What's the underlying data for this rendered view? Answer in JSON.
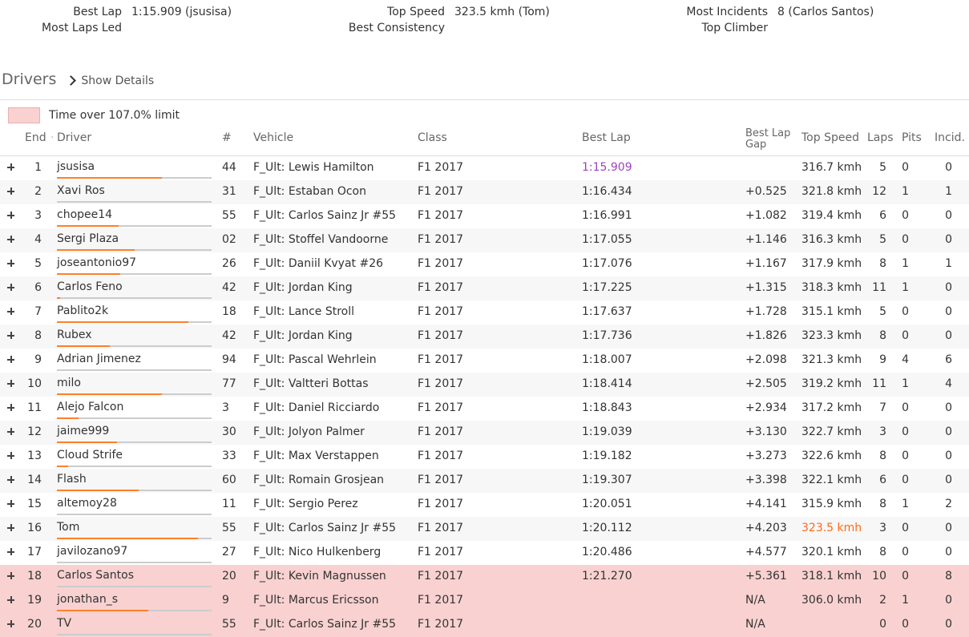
{
  "stats": [
    {
      "label": "Best Lap",
      "value": "1:15.909 (jsusisa)"
    },
    {
      "label": "Most Laps Led",
      "value": ""
    },
    {
      "label": "Top Speed",
      "value": "323.5 kmh (Tom)"
    },
    {
      "label": "Best Consistency",
      "value": ""
    },
    {
      "label": "Most Incidents",
      "value": "8 (Carlos Santos)"
    },
    {
      "label": "Top Climber",
      "value": ""
    }
  ],
  "drivers": {
    "title": "Drivers",
    "show_details": "Show Details"
  },
  "legend": {
    "text": "Time over 107.0% limit",
    "color": "#f9d1d1"
  },
  "columns": {
    "end": "End",
    "driver": "Driver",
    "num": "#",
    "vehicle": "Vehicle",
    "class": "Class",
    "best_lap": "Best Lap",
    "gap_1": "Best Lap",
    "gap_2": "Gap",
    "top_speed": "Top Speed",
    "laps": "Laps",
    "pits": "Pits",
    "incidents": "Incid."
  },
  "colors": {
    "best_lap_highlight": "#a040c0",
    "top_speed_highlight": "#ff6a1a",
    "progress_bar": "#ff7f2a"
  },
  "rows": [
    {
      "end": "1",
      "driver": "jsusisa",
      "num": "44",
      "vehicle": "F_Ult: Lewis Hamilton",
      "class": "F1 2017",
      "best": "1:15.909",
      "gap": "",
      "top": "316.7 kmh",
      "laps": "5",
      "pits": "0",
      "inc": "0",
      "progress": 0.68,
      "best_hl": true
    },
    {
      "end": "2",
      "driver": "Xavi Ros",
      "num": "31",
      "vehicle": "F_Ult: Estaban Ocon",
      "class": "F1 2017",
      "best": "1:16.434",
      "gap": "+0.525",
      "top": "321.8 kmh",
      "laps": "12",
      "pits": "1",
      "inc": "1",
      "progress": 0
    },
    {
      "end": "3",
      "driver": "chopee14",
      "num": "55",
      "vehicle": "F_Ult: Carlos Sainz Jr #55",
      "class": "F1 2017",
      "best": "1:16.991",
      "gap": "+1.082",
      "top": "319.4 kmh",
      "laps": "6",
      "pits": "0",
      "inc": "0",
      "progress": 0.4
    },
    {
      "end": "4",
      "driver": "Sergi Plaza",
      "num": "02",
      "vehicle": "F_Ult: Stoffel Vandoorne",
      "class": "F1 2017",
      "best": "1:17.055",
      "gap": "+1.146",
      "top": "316.3 kmh",
      "laps": "5",
      "pits": "0",
      "inc": "0",
      "progress": 0.5
    },
    {
      "end": "5",
      "driver": "joseantonio97",
      "num": "26",
      "vehicle": "F_Ult: Daniil Kvyat #26",
      "class": "F1 2017",
      "best": "1:17.076",
      "gap": "+1.167",
      "top": "317.9 kmh",
      "laps": "8",
      "pits": "1",
      "inc": "1",
      "progress": 0.41
    },
    {
      "end": "6",
      "driver": "Carlos Feno",
      "num": "42",
      "vehicle": "F_Ult: Jordan King",
      "class": "F1 2017",
      "best": "1:17.225",
      "gap": "+1.315",
      "top": "318.3 kmh",
      "laps": "11",
      "pits": "1",
      "inc": "0",
      "progress": 0.02
    },
    {
      "end": "7",
      "driver": "Pablito2k",
      "num": "18",
      "vehicle": "F_Ult: Lance Stroll",
      "class": "F1 2017",
      "best": "1:17.637",
      "gap": "+1.728",
      "top": "315.1 kmh",
      "laps": "5",
      "pits": "0",
      "inc": "0",
      "progress": 0.85
    },
    {
      "end": "8",
      "driver": "Rubex",
      "num": "42",
      "vehicle": "F_Ult: Jordan King",
      "class": "F1 2017",
      "best": "1:17.736",
      "gap": "+1.826",
      "top": "323.3 kmh",
      "laps": "8",
      "pits": "0",
      "inc": "0",
      "progress": 0.34
    },
    {
      "end": "9",
      "driver": "Adrian Jimenez",
      "num": "94",
      "vehicle": "F_Ult: Pascal Wehrlein",
      "class": "F1 2017",
      "best": "1:18.007",
      "gap": "+2.098",
      "top": "321.3 kmh",
      "laps": "9",
      "pits": "4",
      "inc": "6",
      "progress": 0
    },
    {
      "end": "10",
      "driver": "milo",
      "num": "77",
      "vehicle": "F_Ult: Valtteri Bottas",
      "class": "F1 2017",
      "best": "1:18.414",
      "gap": "+2.505",
      "top": "319.2 kmh",
      "laps": "11",
      "pits": "1",
      "inc": "4",
      "progress": 0.68
    },
    {
      "end": "11",
      "driver": "Alejo Falcon",
      "num": "3",
      "vehicle": "F_Ult: Daniel Ricciardo",
      "class": "F1 2017",
      "best": "1:18.843",
      "gap": "+2.934",
      "top": "317.2 kmh",
      "laps": "7",
      "pits": "0",
      "inc": "0",
      "progress": 0.14
    },
    {
      "end": "12",
      "driver": "jaime999",
      "num": "30",
      "vehicle": "F_Ult: Jolyon Palmer",
      "class": "F1 2017",
      "best": "1:19.039",
      "gap": "+3.130",
      "top": "322.7 kmh",
      "laps": "3",
      "pits": "0",
      "inc": "0",
      "progress": 0.39
    },
    {
      "end": "13",
      "driver": "Cloud Strife",
      "num": "33",
      "vehicle": "F_Ult: Max Verstappen",
      "class": "F1 2017",
      "best": "1:19.182",
      "gap": "+3.273",
      "top": "322.6 kmh",
      "laps": "8",
      "pits": "0",
      "inc": "0",
      "progress": 0.07
    },
    {
      "end": "14",
      "driver": "Flash",
      "num": "60",
      "vehicle": "F_Ult: Romain Grosjean",
      "class": "F1 2017",
      "best": "1:19.307",
      "gap": "+3.398",
      "top": "322.1 kmh",
      "laps": "6",
      "pits": "0",
      "inc": "0",
      "progress": 0.53
    },
    {
      "end": "15",
      "driver": "altemoy28",
      "num": "11",
      "vehicle": "F_Ult: Sergio Perez",
      "class": "F1 2017",
      "best": "1:20.051",
      "gap": "+4.141",
      "top": "315.9 kmh",
      "laps": "8",
      "pits": "1",
      "inc": "2",
      "progress": 0
    },
    {
      "end": "16",
      "driver": "Tom",
      "num": "55",
      "vehicle": "F_Ult: Carlos Sainz Jr #55",
      "class": "F1 2017",
      "best": "1:20.112",
      "gap": "+4.203",
      "top": "323.5 kmh",
      "laps": "3",
      "pits": "0",
      "inc": "0",
      "progress": 0.91,
      "top_hl": true
    },
    {
      "end": "17",
      "driver": "javilozano97",
      "num": "27",
      "vehicle": "F_Ult: Nico Hulkenberg",
      "class": "F1 2017",
      "best": "1:20.486",
      "gap": "+4.577",
      "top": "320.1 kmh",
      "laps": "8",
      "pits": "0",
      "inc": "0",
      "progress": 0
    },
    {
      "end": "18",
      "driver": "Carlos Santos",
      "num": "20",
      "vehicle": "F_Ult: Kevin Magnussen",
      "class": "F1 2017",
      "best": "1:21.270",
      "gap": "+5.361",
      "top": "318.1 kmh",
      "laps": "10",
      "pits": "0",
      "inc": "8",
      "progress": 0,
      "over": true
    },
    {
      "end": "19",
      "driver": "jonathan_s",
      "num": "9",
      "vehicle": "F_Ult: Marcus Ericsson",
      "class": "F1 2017",
      "best": "",
      "gap": "N/A",
      "top": "306.0 kmh",
      "laps": "2",
      "pits": "1",
      "inc": "0",
      "progress": 0.59,
      "over": true
    },
    {
      "end": "20",
      "driver": "TV",
      "num": "55",
      "vehicle": "F_Ult: Carlos Sainz Jr #55",
      "class": "F1 2017",
      "best": "",
      "gap": "N/A",
      "top": "",
      "laps": "0",
      "pits": "0",
      "inc": "0",
      "progress": 0,
      "over": true
    }
  ]
}
